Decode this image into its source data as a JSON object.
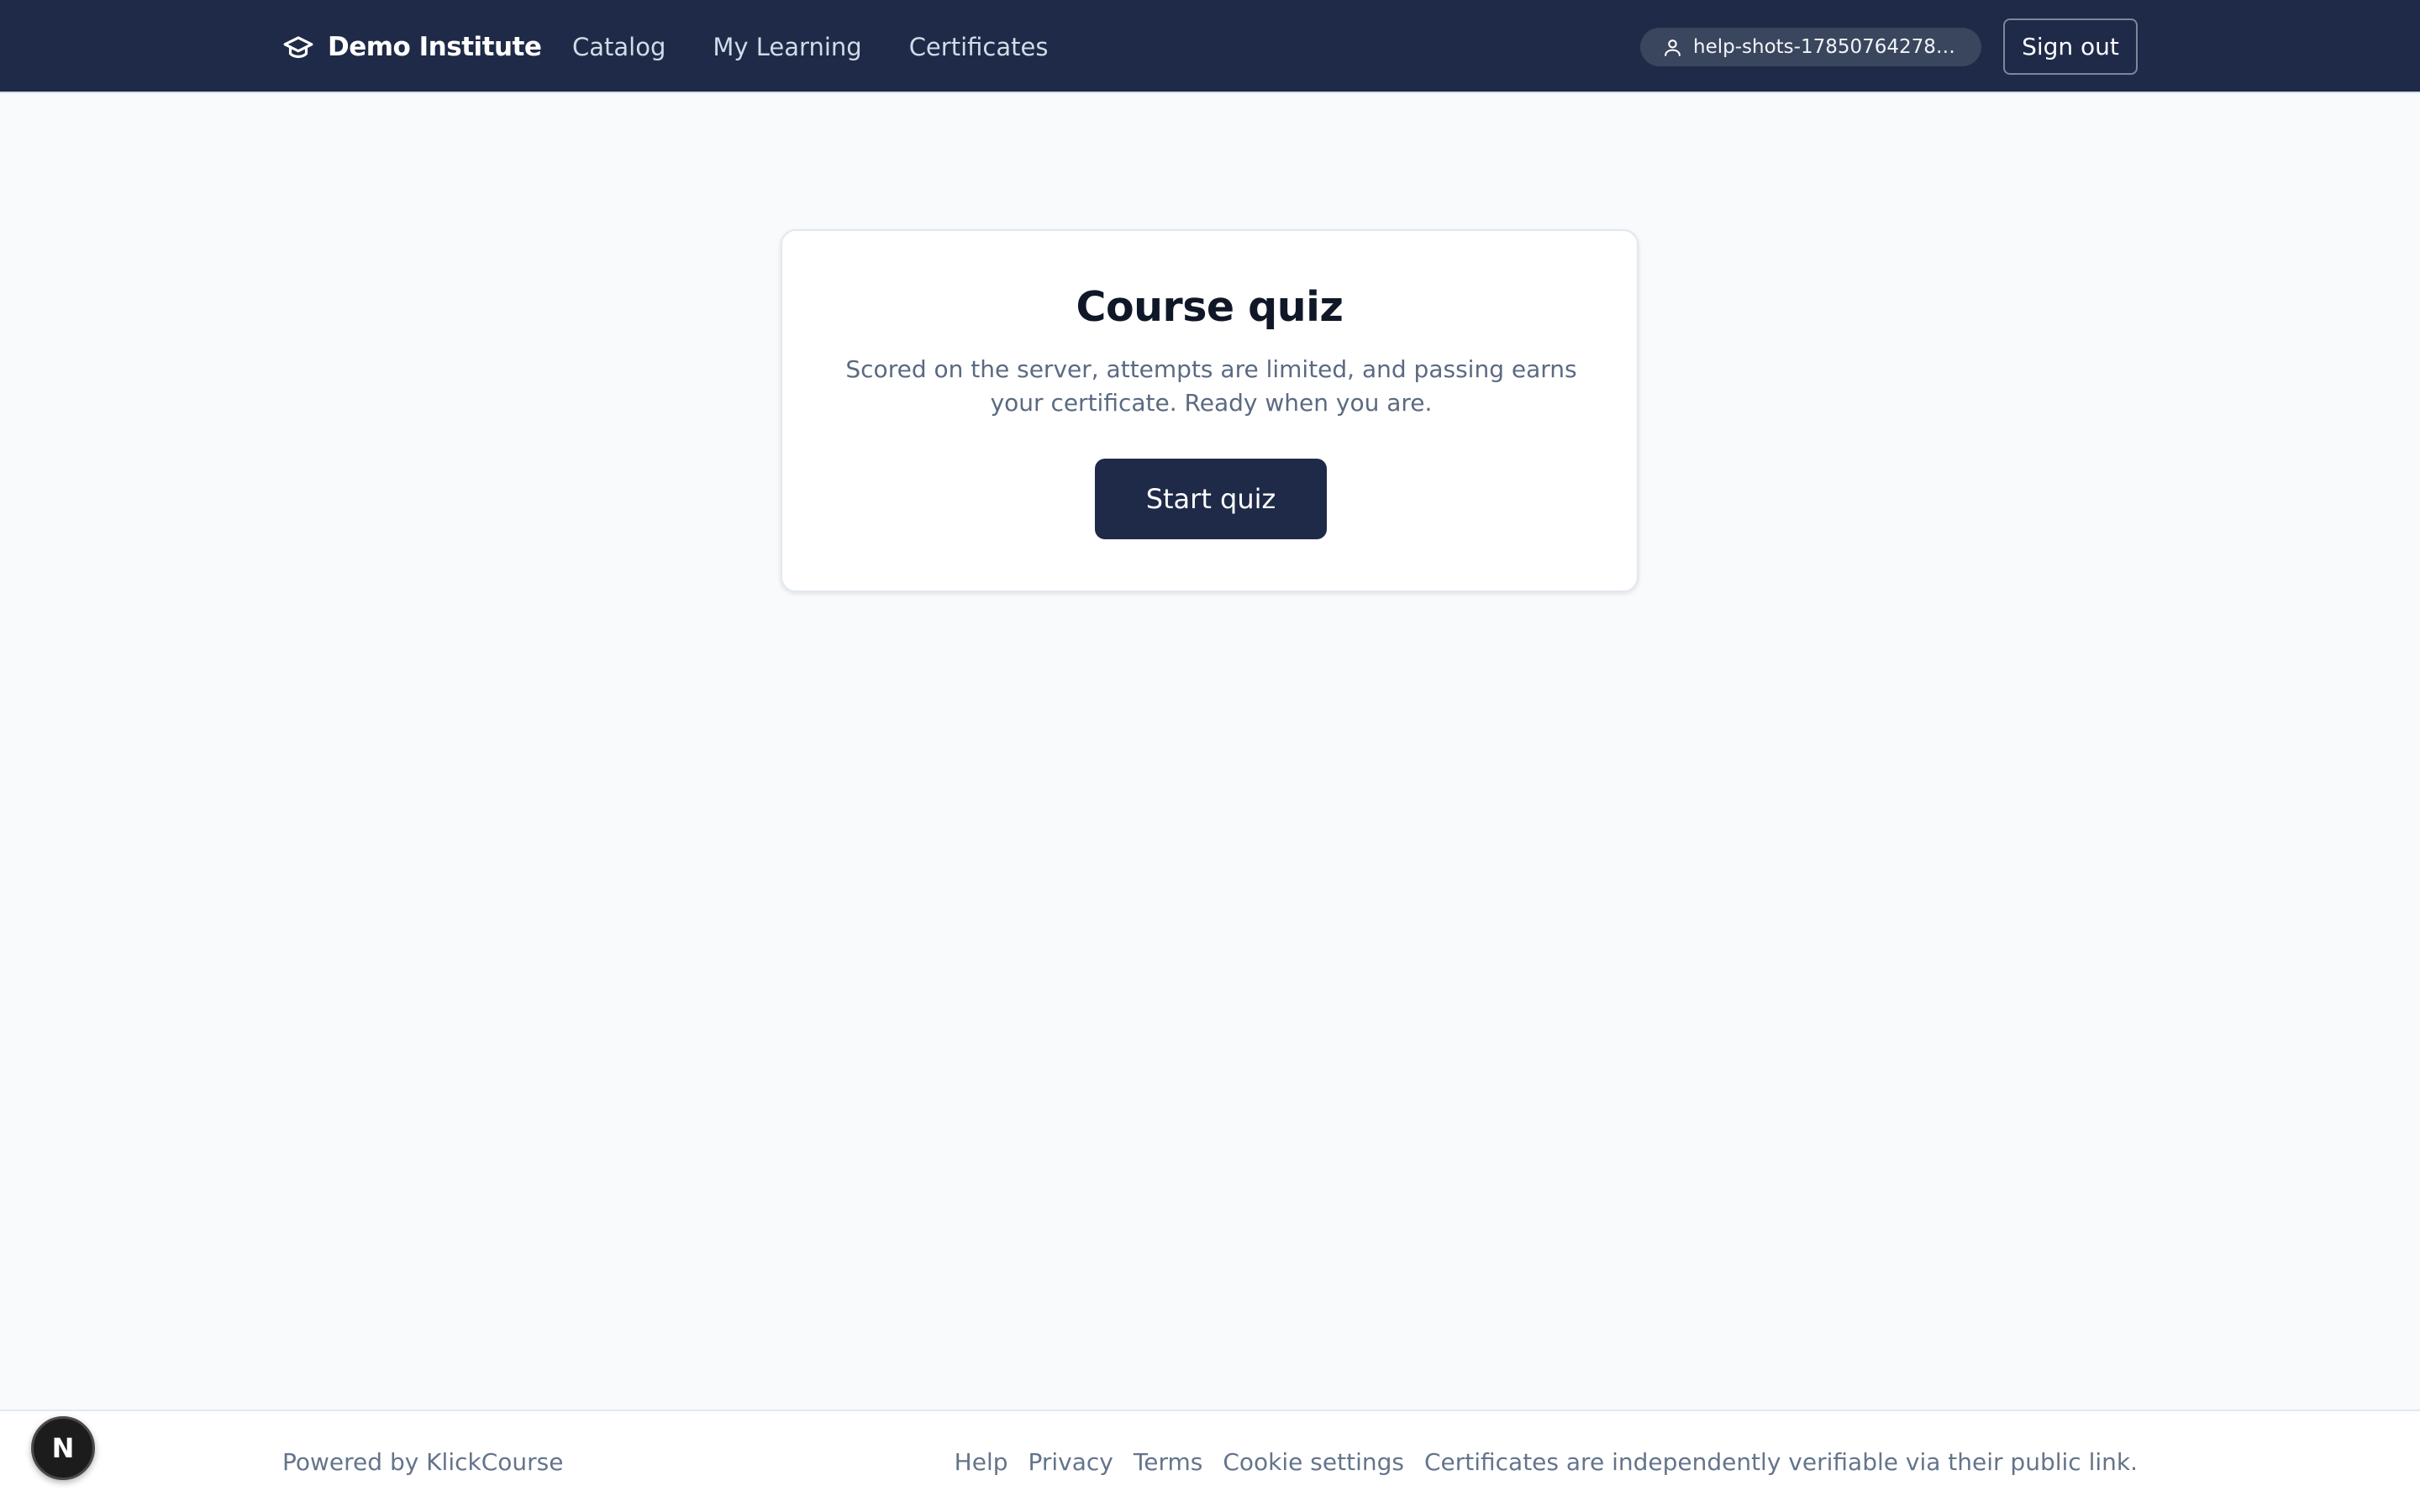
{
  "header": {
    "brand": "Demo Institute",
    "nav": [
      {
        "label": "Catalog"
      },
      {
        "label": "My Learning"
      },
      {
        "label": "Certificates"
      }
    ],
    "user": "help-shots-178507642781...",
    "signout_label": "Sign out"
  },
  "quiz_card": {
    "title": "Course quiz",
    "description": "Scored on the server, attempts are limited, and passing earns your certificate. Ready when you are.",
    "start_label": "Start quiz"
  },
  "footer": {
    "powered_by": "Powered by KlickCourse",
    "links": [
      {
        "label": "Help"
      },
      {
        "label": "Privacy"
      },
      {
        "label": "Terms"
      },
      {
        "label": "Cookie settings"
      }
    ],
    "note": "Certificates are independently verifiable via their public link."
  },
  "floating_badge": {
    "letter": "N"
  },
  "colors": {
    "header_bg": "#1e2a47",
    "page_bg": "#f8fafc",
    "primary_button": "#1e2a47",
    "muted_text": "#64748b"
  },
  "icons": {
    "brand": "graduation-cap-icon",
    "user": "user-icon"
  }
}
